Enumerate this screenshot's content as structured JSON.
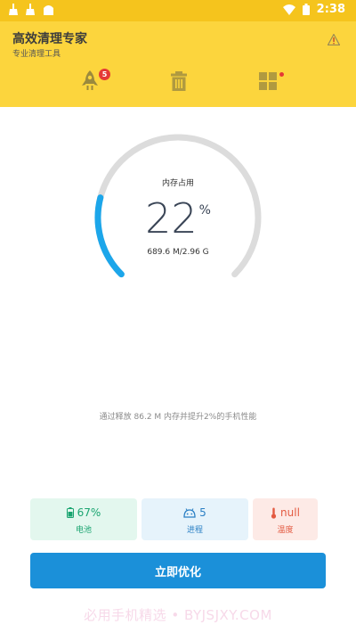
{
  "status_bar": {
    "time": "2:38",
    "icons": [
      "broom-icon",
      "broom-icon",
      "app-icon",
      "wifi-icon",
      "battery-icon"
    ]
  },
  "app_bar": {
    "title": "高效清理专家",
    "subtitle": "专业清理工具",
    "action_icon": "warning-icon",
    "tabs": [
      {
        "icon": "rocket-icon",
        "badge": "5"
      },
      {
        "icon": "trash-icon"
      },
      {
        "icon": "grid-icon",
        "dot": true
      }
    ]
  },
  "gauge": {
    "label": "内存占用",
    "value": "22",
    "unit": "%",
    "percent": 22,
    "memory": "689.6 M/2.96 G"
  },
  "tip": "通过释放 86.2 M 内存并提升2%的手机性能",
  "stats": [
    {
      "icon": "battery-icon",
      "value": "67%",
      "label": "电池"
    },
    {
      "icon": "android-icon",
      "value": "5",
      "label": "进程"
    },
    {
      "icon": "thermometer-icon",
      "value": "null",
      "label": "温度"
    }
  ],
  "action_button": "立即优化",
  "watermark": "必用手机精选 • BYJSJXY.COM",
  "colors": {
    "status_bar": "#f5c41d",
    "app_bar": "#fcd53d",
    "gauge_track": "#dcdcdc",
    "gauge_fill": "#1ca6ea",
    "button": "#1b90d9",
    "badge": "#e53935"
  }
}
